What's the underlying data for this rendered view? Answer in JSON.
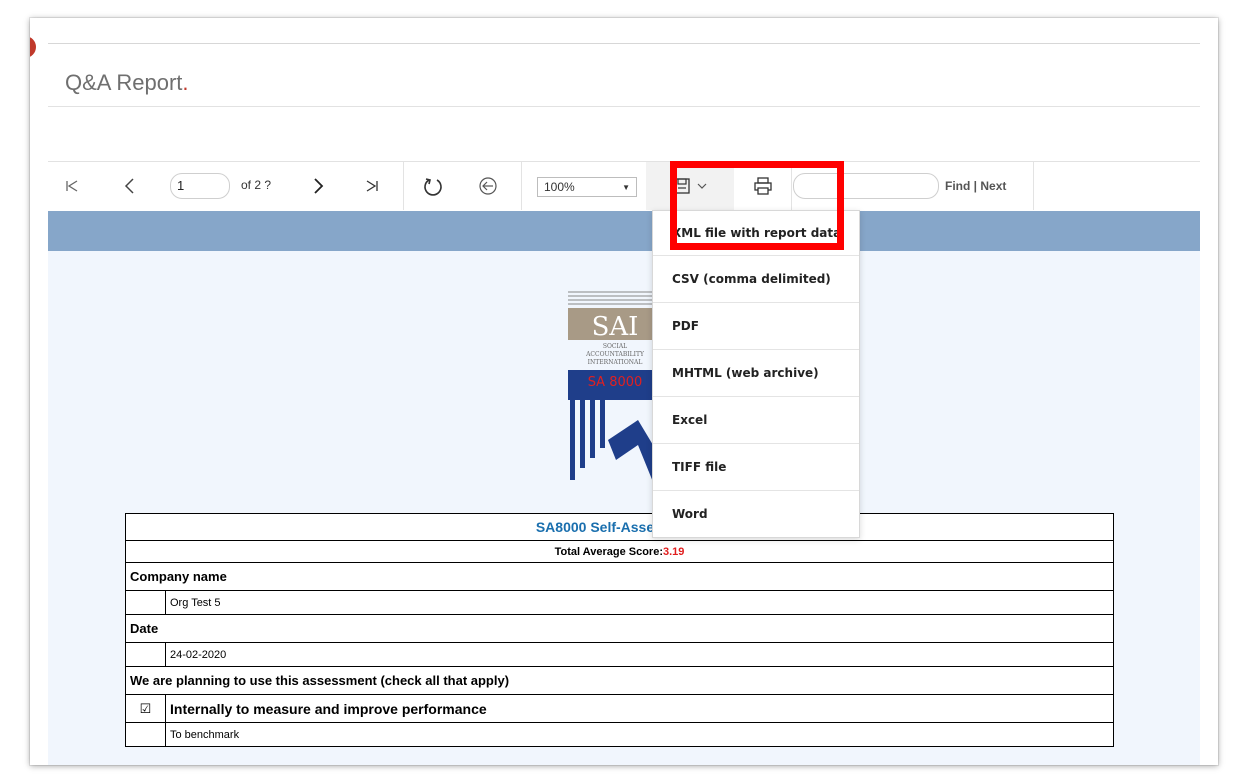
{
  "header": {
    "title": "Q&A Report",
    "title_dot": "."
  },
  "toolbar": {
    "page_input": "1",
    "of_text": "of 2 ?",
    "zoom": "100%",
    "find_label": "Find | Next",
    "icons": [
      "first-page-icon",
      "prev-page-icon",
      "next-page-icon",
      "last-page-icon",
      "refresh-icon",
      "back-icon",
      "save-icon",
      "chevron-down-icon",
      "print-icon"
    ]
  },
  "export_menu": {
    "items": [
      "XML file with report data",
      "CSV (comma delimited)",
      "PDF",
      "MHTML (web archive)",
      "Excel",
      "TIFF file",
      "Word"
    ]
  },
  "logo": {
    "abbr": "SAI",
    "line1": "SOCIAL",
    "line2": "ACCOUNTABILITY",
    "line3": "INTERNATIONAL",
    "standard": "SA 8000"
  },
  "report": {
    "title": "SA8000 Self-Assessment",
    "score_label": "Total Average Score: ",
    "score_value": "3.19",
    "company_label": "Company name",
    "company_value": "Org Test 5",
    "date_label": "Date",
    "date_value": "24-02-2020",
    "planning_label": "We are planning to use this assessment (check all that apply)",
    "option1": "Internally to measure and improve performance",
    "option1_checkbox": "☑",
    "option2": "To benchmark"
  },
  "colors": {
    "accent": "#c0392b",
    "band": "#86a6c9",
    "content_bg": "#f1f6fd",
    "title_blue": "#1a6fae",
    "score_red": "#e01d1d",
    "highlight": "#ff0000"
  }
}
